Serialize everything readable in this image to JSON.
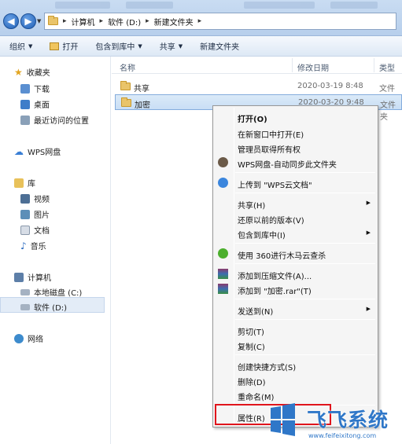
{
  "address": {
    "crumbs": [
      "计算机",
      "软件 (D:)",
      "新建文件夹"
    ]
  },
  "toolbar": {
    "organize": "组织",
    "open": "打开",
    "include_library": "包含到库中",
    "share": "共享",
    "new_folder": "新建文件夹"
  },
  "nav": {
    "favorites": "收藏夹",
    "downloads": "下载",
    "desktop": "桌面",
    "recent": "最近访问的位置",
    "wps_drive": "WPS网盘",
    "libraries": "库",
    "videos": "视频",
    "pictures": "图片",
    "documents": "文档",
    "music": "音乐",
    "computer": "计算机",
    "local_disk": "本地磁盘 (C:)",
    "software_disk": "软件 (D:)",
    "network": "网络"
  },
  "columns": {
    "name": "名称",
    "modified": "修改日期",
    "type": "类型"
  },
  "files": [
    {
      "name": "共享",
      "date": "2020-03-19 8:48",
      "type": "文件夹"
    },
    {
      "name": "加密",
      "date": "2020-03-20 9:48",
      "type": "文件夹"
    }
  ],
  "context_menu": {
    "open": "打开(O)",
    "open_new_window": "在新窗口中打开(E)",
    "take_ownership": "管理员取得所有权",
    "wps_sync": "WPS网盘-自动同步此文件夹",
    "upload_wps": "上传到 \"WPS云文档\"",
    "share": "共享(H)",
    "restore": "还原以前的版本(V)",
    "include_library": "包含到库中(I)",
    "scan_360": "使用 360进行木马云查杀",
    "add_archive": "添加到压缩文件(A)...",
    "add_rar": "添加到 \"加密.rar\"(T)",
    "send_to": "发送到(N)",
    "cut": "剪切(T)",
    "copy": "复制(C)",
    "create_shortcut": "创建快捷方式(S)",
    "delete": "删除(D)",
    "rename": "重命名(M)",
    "properties": "属性(R)"
  },
  "watermark": {
    "title": "飞飞系统",
    "url": "www.feifeixitong.com"
  },
  "colors": {
    "highlight_border": "#e0141c",
    "selection": "#c9def5",
    "watermark_blue": "#2f77c8"
  }
}
